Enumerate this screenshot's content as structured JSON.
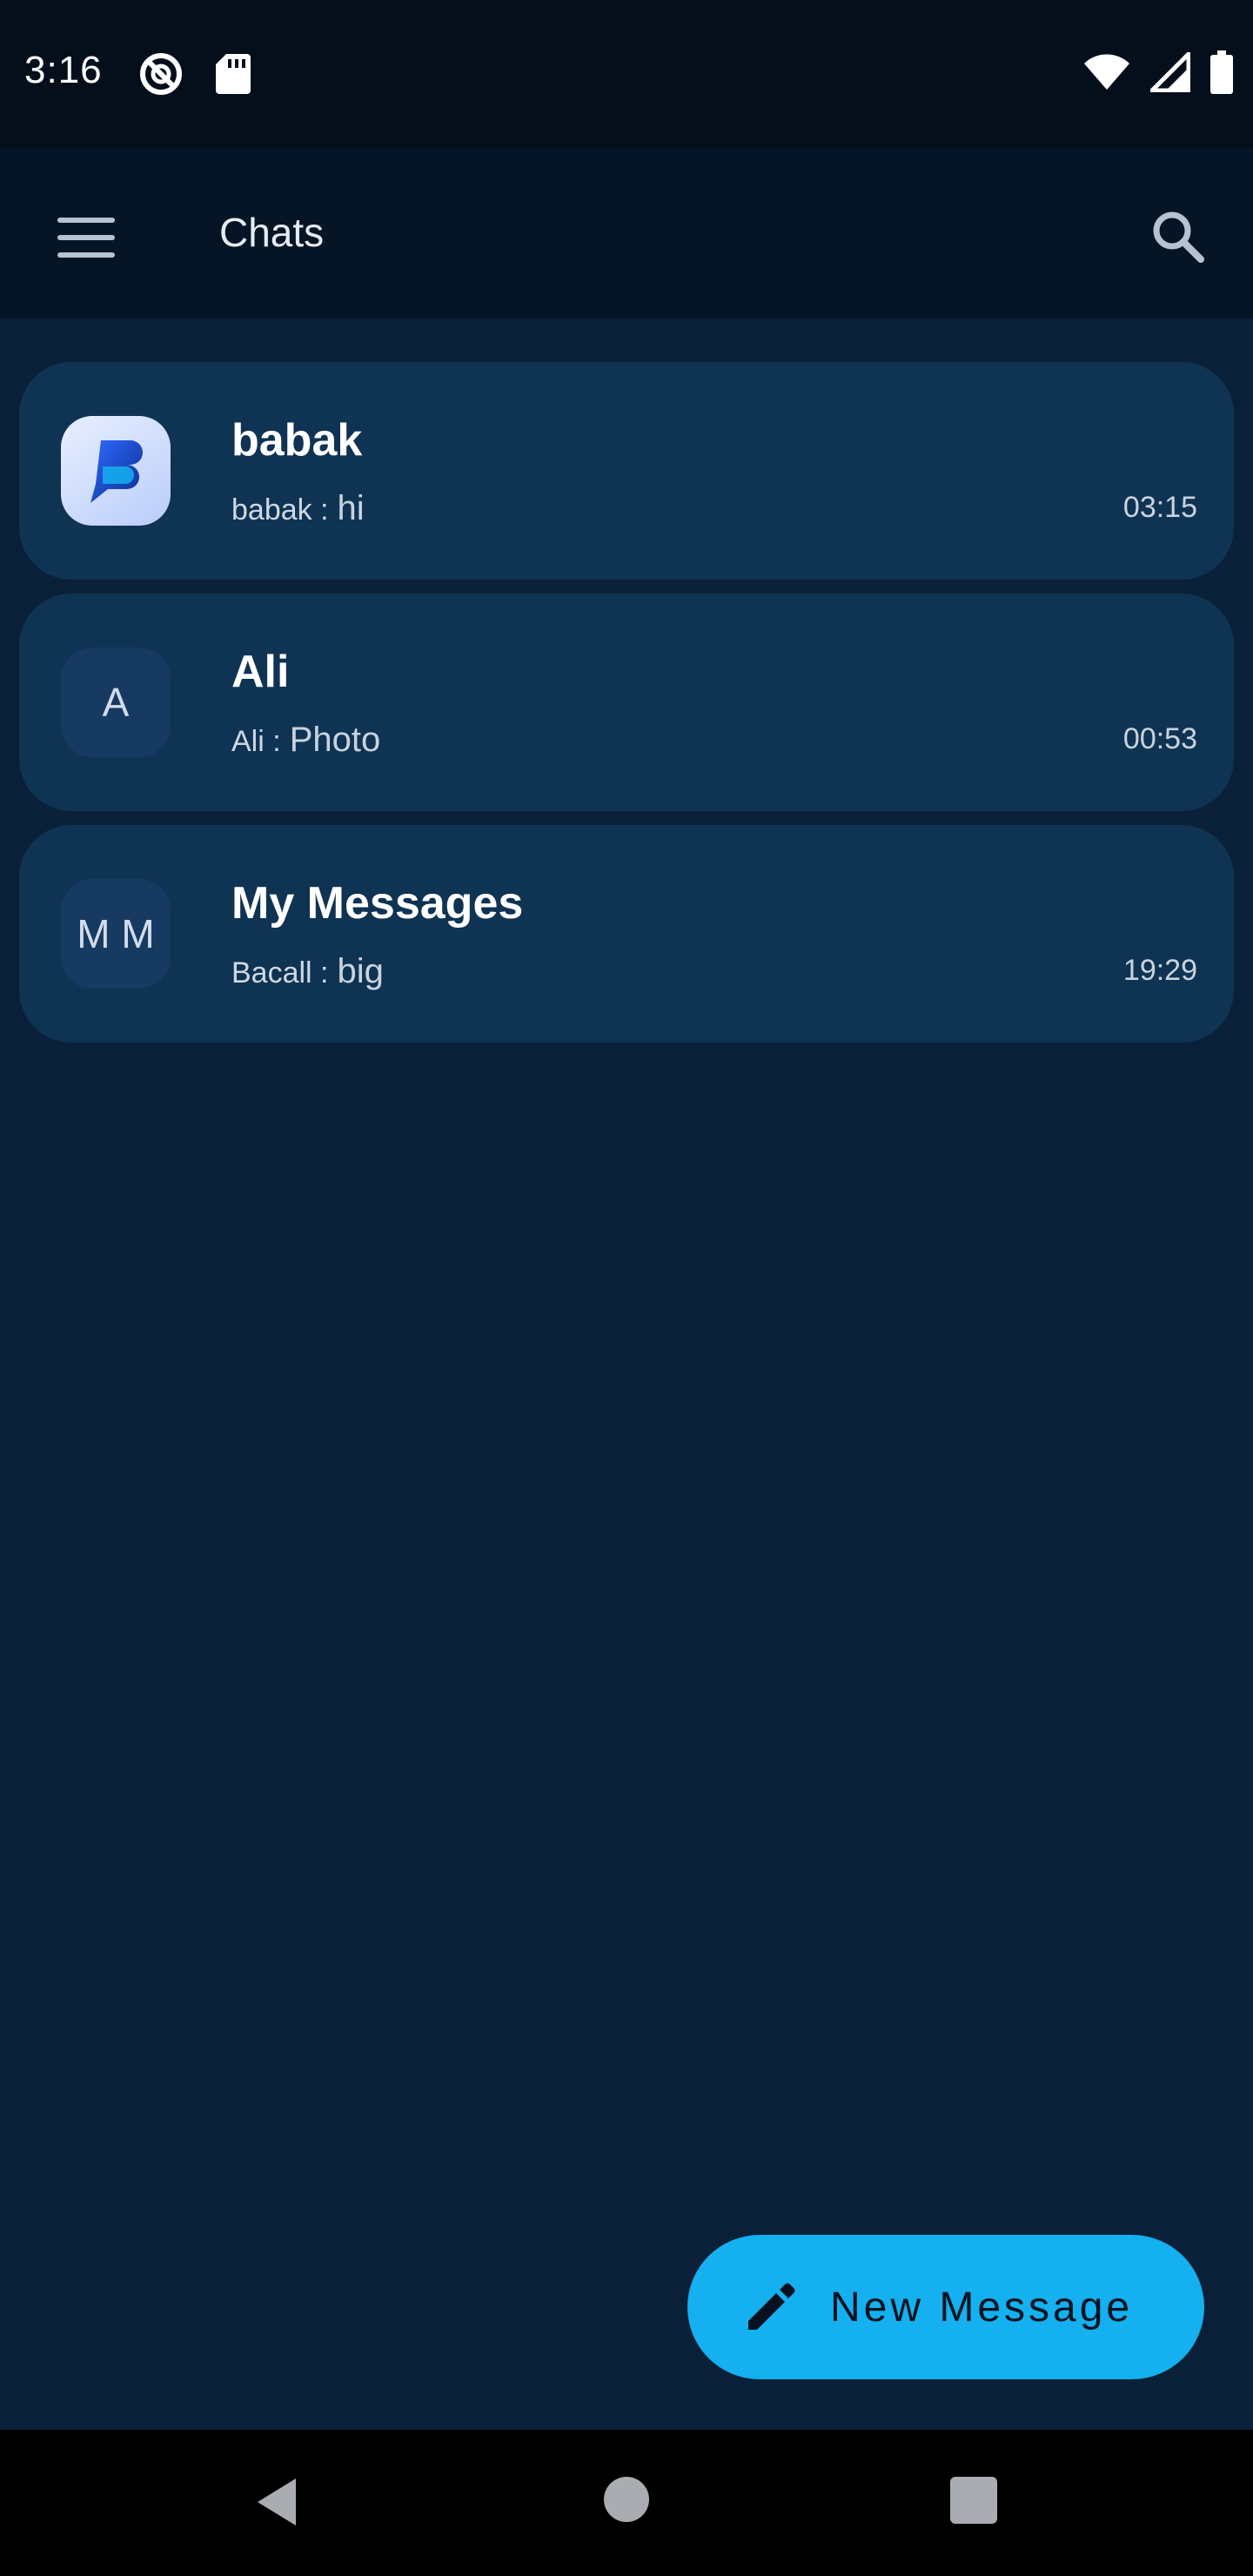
{
  "status_bar": {
    "time": "3:16",
    "left_icons": [
      "vpn-key-icon",
      "sd-card-icon"
    ],
    "right_icons": [
      "wifi-icon",
      "cell-signal-icon",
      "battery-icon"
    ]
  },
  "app_bar": {
    "title": "Chats",
    "menu_icon": "hamburger-menu-icon",
    "search_icon": "search-icon"
  },
  "chats": [
    {
      "name": "babak",
      "avatar_text": "",
      "avatar_type": "logo",
      "sender": "babak :",
      "message": "hi",
      "time": "03:15"
    },
    {
      "name": "Ali",
      "avatar_text": "A",
      "avatar_type": "initials",
      "sender": "Ali :",
      "message": "Photo",
      "time": "00:53"
    },
    {
      "name": "My Messages",
      "avatar_text": "M M",
      "avatar_type": "initials",
      "sender": "Bacall :",
      "message": "big",
      "time": "19:29"
    }
  ],
  "fab": {
    "label": "New Message",
    "icon": "pencil-icon",
    "color": "#14b0ef"
  },
  "nav_bar": {
    "icons": [
      "back-icon",
      "home-icon",
      "recents-icon"
    ]
  },
  "colors": {
    "background": "#0a2038",
    "card": "#0f3353",
    "app_bar": "#051526",
    "accent": "#14b0ef"
  }
}
